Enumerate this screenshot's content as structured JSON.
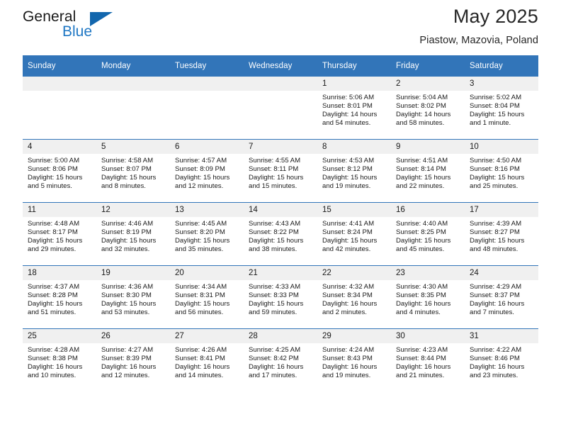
{
  "logo": {
    "word_one": "General",
    "word_two": "Blue",
    "triangle_icon": "triangle-icon"
  },
  "header": {
    "title": "May 2025",
    "subtitle": "Piastow, Mazovia, Poland"
  },
  "colors": {
    "header_blue": "#3275b9",
    "daynum_gray": "#f0f0f0",
    "logo_blue": "#1f77c4",
    "text": "#1a1a1a"
  },
  "calendar": {
    "weekday_headers": [
      "Sunday",
      "Monday",
      "Tuesday",
      "Wednesday",
      "Thursday",
      "Friday",
      "Saturday"
    ],
    "weeks": [
      [
        {
          "day": "",
          "empty": true
        },
        {
          "day": "",
          "empty": true
        },
        {
          "day": "",
          "empty": true
        },
        {
          "day": "",
          "empty": true
        },
        {
          "day": "1",
          "sunrise": "Sunrise: 5:06 AM",
          "sunset": "Sunset: 8:01 PM",
          "daylight1": "Daylight: 14 hours",
          "daylight2": "and 54 minutes."
        },
        {
          "day": "2",
          "sunrise": "Sunrise: 5:04 AM",
          "sunset": "Sunset: 8:02 PM",
          "daylight1": "Daylight: 14 hours",
          "daylight2": "and 58 minutes."
        },
        {
          "day": "3",
          "sunrise": "Sunrise: 5:02 AM",
          "sunset": "Sunset: 8:04 PM",
          "daylight1": "Daylight: 15 hours",
          "daylight2": "and 1 minute."
        }
      ],
      [
        {
          "day": "4",
          "sunrise": "Sunrise: 5:00 AM",
          "sunset": "Sunset: 8:06 PM",
          "daylight1": "Daylight: 15 hours",
          "daylight2": "and 5 minutes."
        },
        {
          "day": "5",
          "sunrise": "Sunrise: 4:58 AM",
          "sunset": "Sunset: 8:07 PM",
          "daylight1": "Daylight: 15 hours",
          "daylight2": "and 8 minutes."
        },
        {
          "day": "6",
          "sunrise": "Sunrise: 4:57 AM",
          "sunset": "Sunset: 8:09 PM",
          "daylight1": "Daylight: 15 hours",
          "daylight2": "and 12 minutes."
        },
        {
          "day": "7",
          "sunrise": "Sunrise: 4:55 AM",
          "sunset": "Sunset: 8:11 PM",
          "daylight1": "Daylight: 15 hours",
          "daylight2": "and 15 minutes."
        },
        {
          "day": "8",
          "sunrise": "Sunrise: 4:53 AM",
          "sunset": "Sunset: 8:12 PM",
          "daylight1": "Daylight: 15 hours",
          "daylight2": "and 19 minutes."
        },
        {
          "day": "9",
          "sunrise": "Sunrise: 4:51 AM",
          "sunset": "Sunset: 8:14 PM",
          "daylight1": "Daylight: 15 hours",
          "daylight2": "and 22 minutes."
        },
        {
          "day": "10",
          "sunrise": "Sunrise: 4:50 AM",
          "sunset": "Sunset: 8:16 PM",
          "daylight1": "Daylight: 15 hours",
          "daylight2": "and 25 minutes."
        }
      ],
      [
        {
          "day": "11",
          "sunrise": "Sunrise: 4:48 AM",
          "sunset": "Sunset: 8:17 PM",
          "daylight1": "Daylight: 15 hours",
          "daylight2": "and 29 minutes."
        },
        {
          "day": "12",
          "sunrise": "Sunrise: 4:46 AM",
          "sunset": "Sunset: 8:19 PM",
          "daylight1": "Daylight: 15 hours",
          "daylight2": "and 32 minutes."
        },
        {
          "day": "13",
          "sunrise": "Sunrise: 4:45 AM",
          "sunset": "Sunset: 8:20 PM",
          "daylight1": "Daylight: 15 hours",
          "daylight2": "and 35 minutes."
        },
        {
          "day": "14",
          "sunrise": "Sunrise: 4:43 AM",
          "sunset": "Sunset: 8:22 PM",
          "daylight1": "Daylight: 15 hours",
          "daylight2": "and 38 minutes."
        },
        {
          "day": "15",
          "sunrise": "Sunrise: 4:41 AM",
          "sunset": "Sunset: 8:24 PM",
          "daylight1": "Daylight: 15 hours",
          "daylight2": "and 42 minutes."
        },
        {
          "day": "16",
          "sunrise": "Sunrise: 4:40 AM",
          "sunset": "Sunset: 8:25 PM",
          "daylight1": "Daylight: 15 hours",
          "daylight2": "and 45 minutes."
        },
        {
          "day": "17",
          "sunrise": "Sunrise: 4:39 AM",
          "sunset": "Sunset: 8:27 PM",
          "daylight1": "Daylight: 15 hours",
          "daylight2": "and 48 minutes."
        }
      ],
      [
        {
          "day": "18",
          "sunrise": "Sunrise: 4:37 AM",
          "sunset": "Sunset: 8:28 PM",
          "daylight1": "Daylight: 15 hours",
          "daylight2": "and 51 minutes."
        },
        {
          "day": "19",
          "sunrise": "Sunrise: 4:36 AM",
          "sunset": "Sunset: 8:30 PM",
          "daylight1": "Daylight: 15 hours",
          "daylight2": "and 53 minutes."
        },
        {
          "day": "20",
          "sunrise": "Sunrise: 4:34 AM",
          "sunset": "Sunset: 8:31 PM",
          "daylight1": "Daylight: 15 hours",
          "daylight2": "and 56 minutes."
        },
        {
          "day": "21",
          "sunrise": "Sunrise: 4:33 AM",
          "sunset": "Sunset: 8:33 PM",
          "daylight1": "Daylight: 15 hours",
          "daylight2": "and 59 minutes."
        },
        {
          "day": "22",
          "sunrise": "Sunrise: 4:32 AM",
          "sunset": "Sunset: 8:34 PM",
          "daylight1": "Daylight: 16 hours",
          "daylight2": "and 2 minutes."
        },
        {
          "day": "23",
          "sunrise": "Sunrise: 4:30 AM",
          "sunset": "Sunset: 8:35 PM",
          "daylight1": "Daylight: 16 hours",
          "daylight2": "and 4 minutes."
        },
        {
          "day": "24",
          "sunrise": "Sunrise: 4:29 AM",
          "sunset": "Sunset: 8:37 PM",
          "daylight1": "Daylight: 16 hours",
          "daylight2": "and 7 minutes."
        }
      ],
      [
        {
          "day": "25",
          "sunrise": "Sunrise: 4:28 AM",
          "sunset": "Sunset: 8:38 PM",
          "daylight1": "Daylight: 16 hours",
          "daylight2": "and 10 minutes."
        },
        {
          "day": "26",
          "sunrise": "Sunrise: 4:27 AM",
          "sunset": "Sunset: 8:39 PM",
          "daylight1": "Daylight: 16 hours",
          "daylight2": "and 12 minutes."
        },
        {
          "day": "27",
          "sunrise": "Sunrise: 4:26 AM",
          "sunset": "Sunset: 8:41 PM",
          "daylight1": "Daylight: 16 hours",
          "daylight2": "and 14 minutes."
        },
        {
          "day": "28",
          "sunrise": "Sunrise: 4:25 AM",
          "sunset": "Sunset: 8:42 PM",
          "daylight1": "Daylight: 16 hours",
          "daylight2": "and 17 minutes."
        },
        {
          "day": "29",
          "sunrise": "Sunrise: 4:24 AM",
          "sunset": "Sunset: 8:43 PM",
          "daylight1": "Daylight: 16 hours",
          "daylight2": "and 19 minutes."
        },
        {
          "day": "30",
          "sunrise": "Sunrise: 4:23 AM",
          "sunset": "Sunset: 8:44 PM",
          "daylight1": "Daylight: 16 hours",
          "daylight2": "and 21 minutes."
        },
        {
          "day": "31",
          "sunrise": "Sunrise: 4:22 AM",
          "sunset": "Sunset: 8:46 PM",
          "daylight1": "Daylight: 16 hours",
          "daylight2": "and 23 minutes."
        }
      ]
    ]
  }
}
